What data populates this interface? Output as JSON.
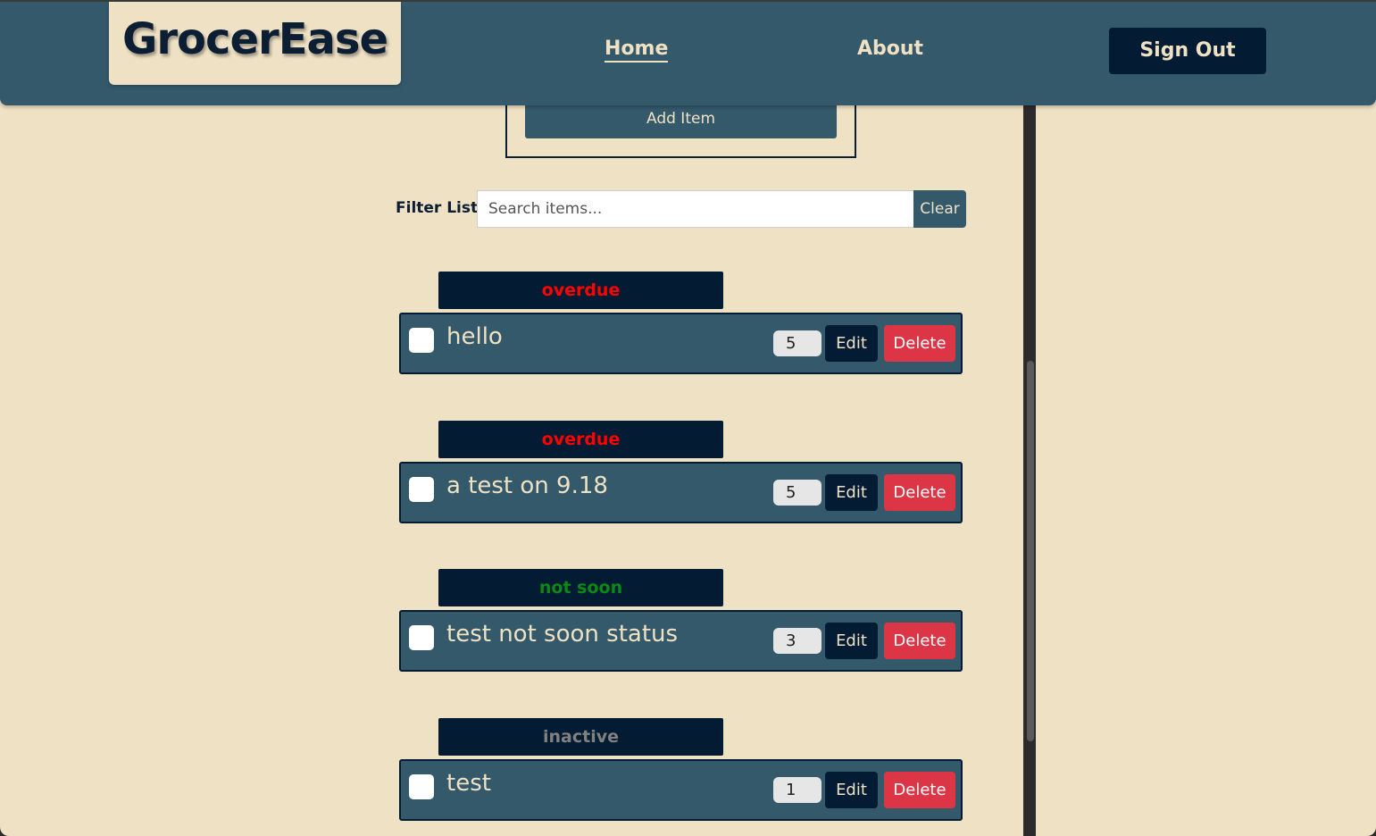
{
  "header": {
    "logo": "GrocerEase",
    "nav": [
      {
        "label": "Home",
        "active": true
      },
      {
        "label": "About",
        "active": false
      }
    ],
    "signout_label": "Sign Out"
  },
  "add_form": {
    "add_label": "Add Item"
  },
  "filter": {
    "label": "Filter List:",
    "placeholder": "Search items...",
    "value": "",
    "clear_label": "Clear"
  },
  "status_colors": {
    "overdue": "#ff0000",
    "not_soon": "#008000",
    "inactive": "#808080"
  },
  "items": [
    {
      "status": "overdue",
      "name": "hello",
      "qty": "5",
      "checked": false,
      "edit": "Edit",
      "delete": "Delete"
    },
    {
      "status": "overdue",
      "name": "a test on 9.18",
      "qty": "5",
      "checked": false,
      "edit": "Edit",
      "delete": "Delete"
    },
    {
      "status": "not soon",
      "name": "test not soon status",
      "qty": "3",
      "checked": false,
      "edit": "Edit",
      "delete": "Delete"
    },
    {
      "status": "inactive",
      "name": "test",
      "qty": "1",
      "checked": false,
      "edit": "Edit",
      "delete": "Delete"
    }
  ]
}
